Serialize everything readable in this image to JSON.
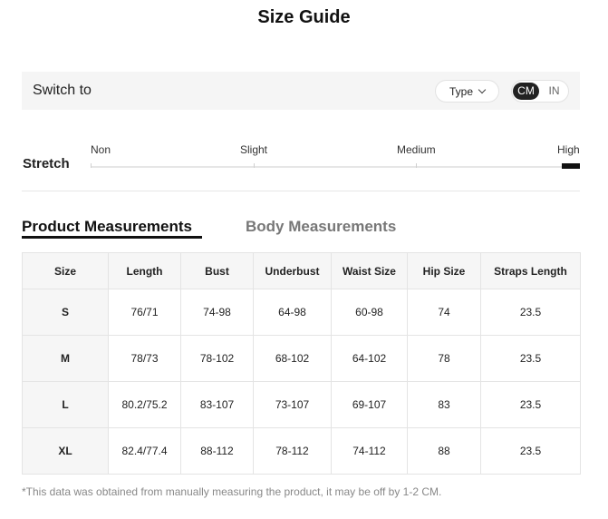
{
  "title": "Size Guide",
  "switch": {
    "label": "Switch to",
    "type_label": "Type",
    "units": [
      "CM",
      "IN"
    ],
    "selected_unit": "CM"
  },
  "stretch": {
    "label": "Stretch",
    "levels": [
      "Non",
      "Slight",
      "Medium",
      "High"
    ],
    "selected": "High"
  },
  "tabs": [
    {
      "label": "Product Measurements",
      "active": true
    },
    {
      "label": "Body Measurements",
      "active": false
    }
  ],
  "table": {
    "headers": [
      "Size",
      "Length",
      "Bust",
      "Underbust",
      "Waist Size",
      "Hip Size",
      "Straps Length"
    ],
    "rows": [
      [
        "S",
        "76/71",
        "74-98",
        "64-98",
        "60-98",
        "74",
        "23.5"
      ],
      [
        "M",
        "78/73",
        "78-102",
        "68-102",
        "64-102",
        "78",
        "23.5"
      ],
      [
        "L",
        "80.2/75.2",
        "83-107",
        "73-107",
        "69-107",
        "83",
        "23.5"
      ],
      [
        "XL",
        "82.4/77.4",
        "88-112",
        "78-112",
        "74-112",
        "88",
        "23.5"
      ]
    ]
  },
  "footnote": "*This data was obtained from manually measuring the product, it may be off by 1-2 CM."
}
